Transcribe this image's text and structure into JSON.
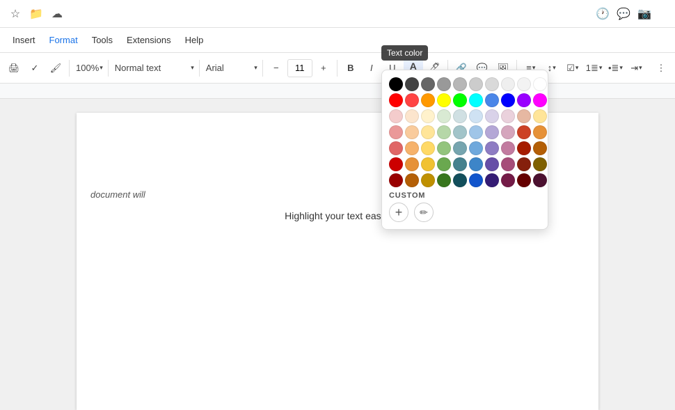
{
  "topbar": {
    "icons": [
      "☆",
      "📁",
      "☁"
    ]
  },
  "menubar": {
    "items": [
      "Insert",
      "Format",
      "Tools",
      "Extensions",
      "Help"
    ]
  },
  "toolbar": {
    "zoom": "100%",
    "style": "Normal text",
    "font": "Arial",
    "fontSize": "11",
    "bold": "B",
    "italic": "I",
    "underline": "U",
    "textColorLabel": "A",
    "highlightLabel": "A",
    "linkLabel": "🔗",
    "imageLabel": "🖼",
    "pictureLabel": "📷",
    "alignLabel": "≡",
    "lineSpacing": "↕",
    "format1": "⊟",
    "listOrdered": "≣",
    "listUnordered": "☰",
    "indent": "⇥"
  },
  "document": {
    "sideText": "document will",
    "mainText": "Highlight your text easily"
  },
  "colorPicker": {
    "tooltip": "Text color",
    "customLabel": "CUSTOM",
    "addLabel": "+",
    "pickLabel": "✏",
    "rows": [
      [
        "#000000",
        "#434343",
        "#666666",
        "#999999",
        "#b7b7b7",
        "#cccccc",
        "#d9d9d9",
        "#efefef",
        "#f3f3f3",
        "#ffffff"
      ],
      [
        "#ff0000",
        "#ff4444",
        "#ff9900",
        "#ffff00",
        "#00ff00",
        "#00ffff",
        "#4a86e8",
        "#0000ff",
        "#9900ff",
        "#ff00ff"
      ],
      [
        "#f4cccc",
        "#fce5cd",
        "#fff2cc",
        "#d9ead3",
        "#d0e0e3",
        "#cfe2f3",
        "#d9d2e9",
        "#ead1dc",
        "#e6b8a2",
        "#ffe599"
      ],
      [
        "#ea9999",
        "#f9cb9c",
        "#ffe599",
        "#b6d7a8",
        "#a2c4c9",
        "#9fc5e8",
        "#b4a7d6",
        "#d5a6bd",
        "#cc4125",
        "#e69138"
      ],
      [
        "#e06666",
        "#f6b26b",
        "#ffd966",
        "#93c47d",
        "#76a5af",
        "#6fa8dc",
        "#8e7cc3",
        "#c27ba0",
        "#a61c00",
        "#b45f06"
      ],
      [
        "#cc0000",
        "#e69138",
        "#f1c232",
        "#6aa84f",
        "#45818e",
        "#3d85c8",
        "#674ea7",
        "#a64d79",
        "#85200c",
        "#7f6000"
      ],
      [
        "#990000",
        "#b45f06",
        "#bf9000",
        "#38761d",
        "#134f5c",
        "#1155cc",
        "#351c75",
        "#741b47",
        "#660000",
        "#4c1130"
      ]
    ]
  }
}
